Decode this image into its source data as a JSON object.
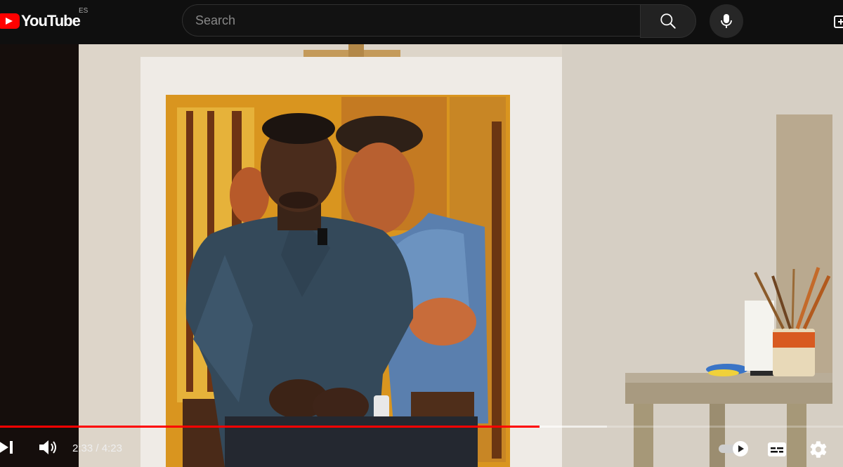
{
  "header": {
    "logo_text": "YouTube",
    "country_code": "ES",
    "search": {
      "placeholder": "Search",
      "value": ""
    }
  },
  "player": {
    "current_time": "2:33",
    "duration": "4:23",
    "time_separator": " / ",
    "played_fraction": 0.64,
    "buffered_fraction": 0.72
  },
  "colors": {
    "brand_red": "#ff0000",
    "topbar_bg": "#0f0f0f"
  },
  "icons": [
    "youtube-logo-icon",
    "search-icon",
    "mic-icon",
    "create-icon",
    "next-icon",
    "volume-icon",
    "autoplay-toggle-icon",
    "captions-icon",
    "settings-gear-icon"
  ]
}
